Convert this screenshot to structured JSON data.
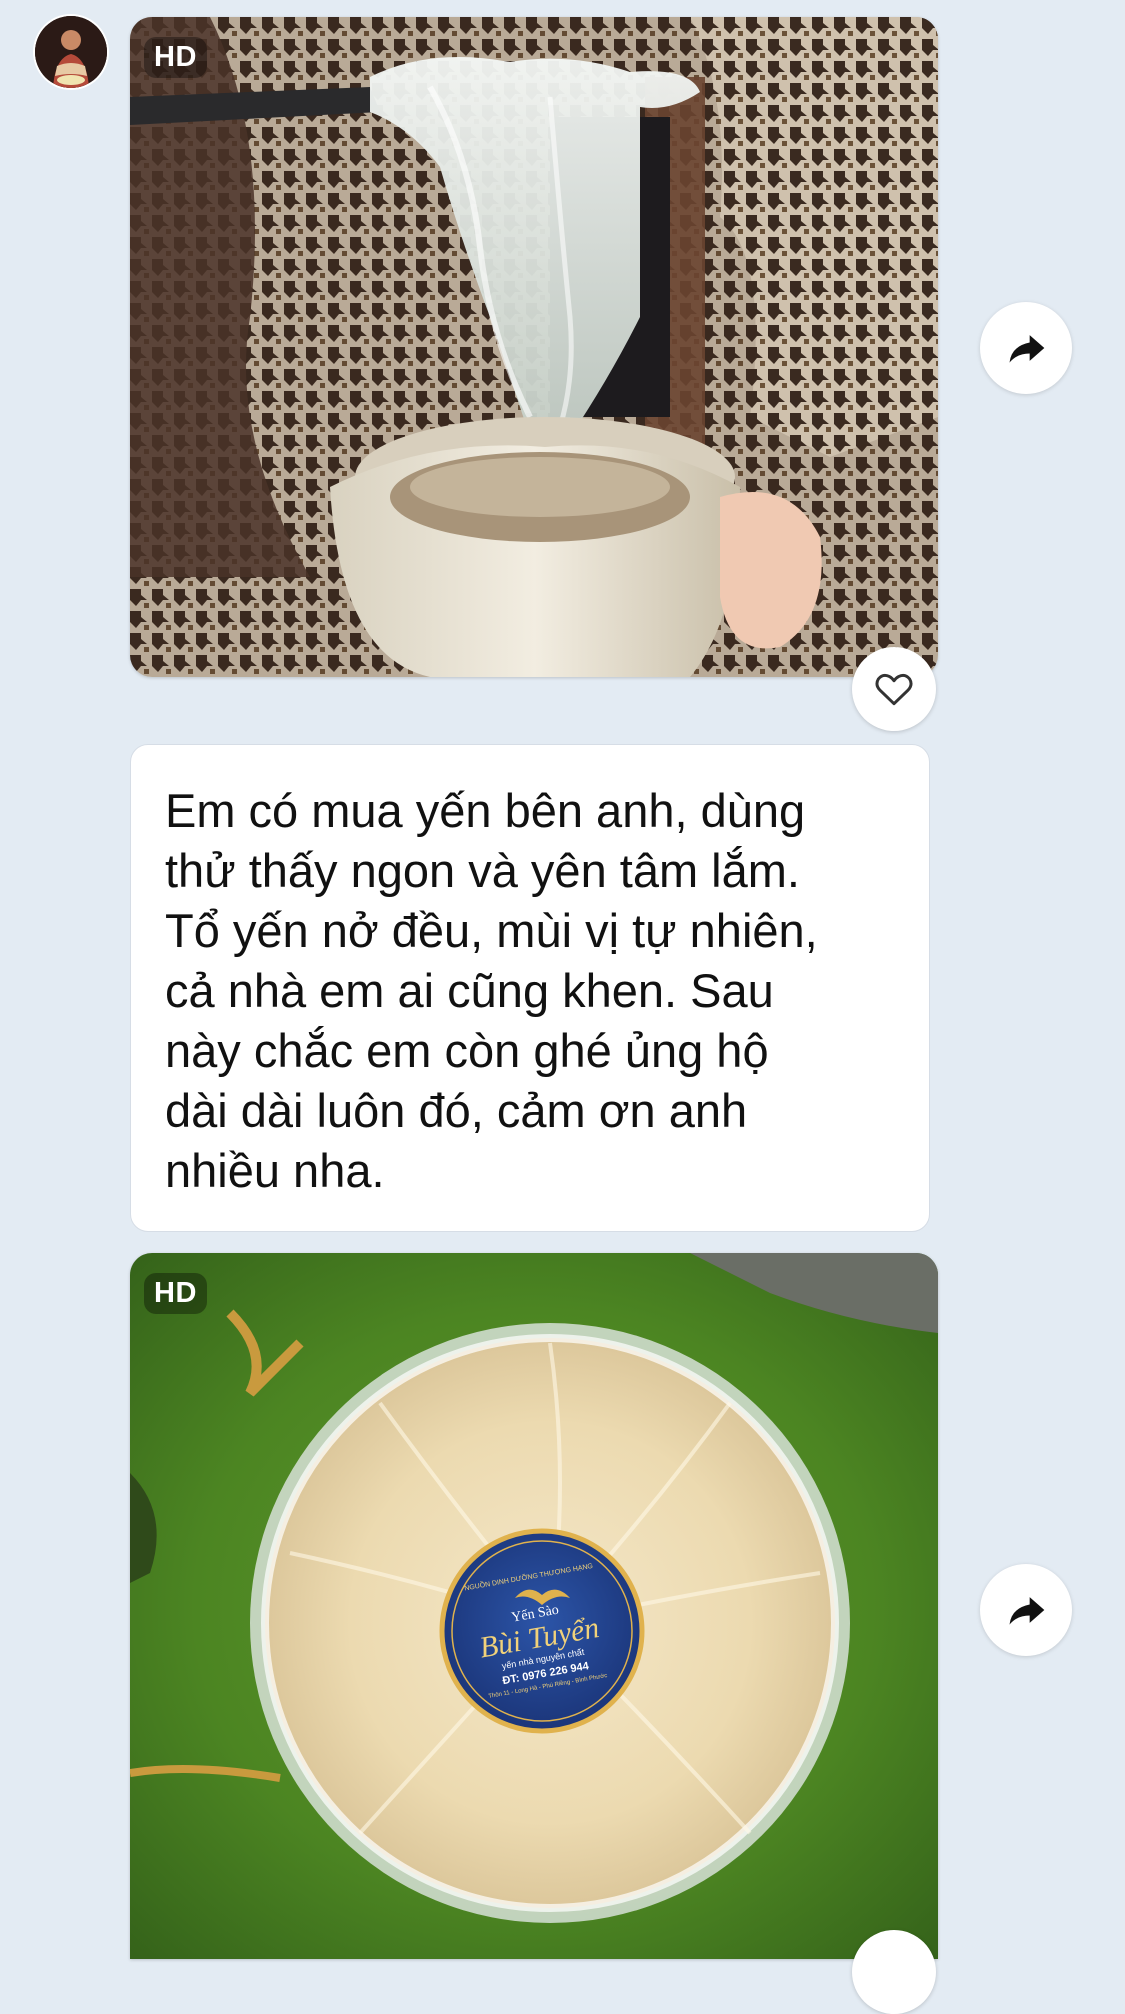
{
  "conversation": {
    "avatar_icon": "user-avatar",
    "messages": [
      {
        "type": "image",
        "badge": "HD",
        "description_icon": "photo-bird-nest-in-coconut",
        "actions": {
          "share_icon": "share-arrow-icon",
          "react_icon": "heart-icon"
        }
      },
      {
        "type": "text",
        "text": "Em có mua yến bên anh, dùng\nthử thấy ngon và yên tâm lắm.\nTổ yến nở đều, mùi vị tự nhiên,\ncả nhà em ai cũng khen. Sau\nnày chắc em còn ghé ủng hộ\ndài dài luôn đó, cảm ơn anh\nnhiều nha."
      },
      {
        "type": "image",
        "badge": "HD",
        "description_icon": "photo-bird-nest-box-on-moss",
        "label": {
          "arc_top": "NGUỒN DINH DƯỠNG THƯỢNG HẠNG",
          "brand_small": "Yến Sào",
          "brand_name": "Bùi Tuyển",
          "tagline": "yến nhà nguyên chất",
          "phone": "ĐT: 0976 226 944",
          "address": "Thôn 11 - Long Hà - Phú Riềng - Bình Phước"
        },
        "actions": {
          "share_icon": "share-arrow-icon",
          "react_icon": "heart-icon"
        }
      }
    ]
  }
}
